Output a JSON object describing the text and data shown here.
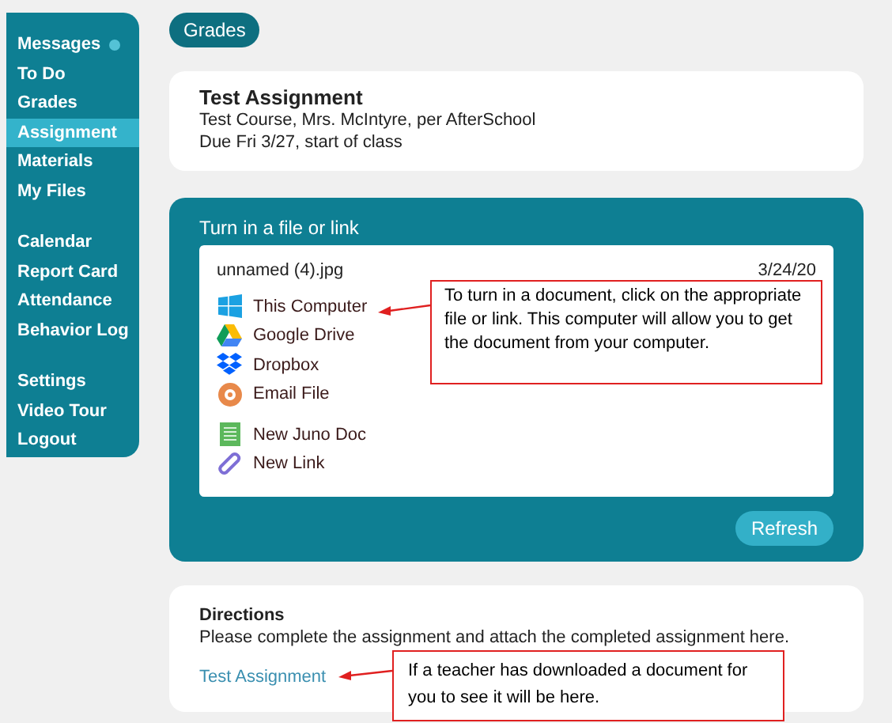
{
  "sidebar": {
    "groups": [
      [
        {
          "label": "Messages",
          "selected": false,
          "unread": true
        },
        {
          "label": "To Do",
          "selected": false,
          "unread": false
        },
        {
          "label": "Grades",
          "selected": false,
          "unread": false
        },
        {
          "label": "Assignment",
          "selected": true,
          "unread": false
        },
        {
          "label": "Materials",
          "selected": false,
          "unread": false
        },
        {
          "label": "My Files",
          "selected": false,
          "unread": false
        }
      ],
      [
        {
          "label": "Calendar",
          "selected": false,
          "unread": false
        },
        {
          "label": "Report Card",
          "selected": false,
          "unread": false
        },
        {
          "label": "Attendance",
          "selected": false,
          "unread": false
        },
        {
          "label": "Behavior Log",
          "selected": false,
          "unread": false
        }
      ],
      [
        {
          "label": "Settings",
          "selected": false,
          "unread": false
        },
        {
          "label": "Video Tour",
          "selected": false,
          "unread": false
        },
        {
          "label": "Logout",
          "selected": false,
          "unread": false
        }
      ]
    ]
  },
  "breadcrumb": "Grades",
  "assignment": {
    "title": "Test Assignment",
    "course": "Test Course, Mrs. McIntyre, per AfterSchool",
    "due": "Due Fri 3/27, start of class"
  },
  "turn_in": {
    "heading": "Turn in a file or link",
    "file_name": "unnamed (4).jpg",
    "file_date": "3/24/20",
    "source_groups": [
      [
        {
          "kind": "windows",
          "label": "This Computer"
        },
        {
          "kind": "drive",
          "label": "Google Drive"
        },
        {
          "kind": "dropbox",
          "label": "Dropbox"
        },
        {
          "kind": "email",
          "label": "Email File"
        }
      ],
      [
        {
          "kind": "doc",
          "label": "New Juno Doc"
        },
        {
          "kind": "link",
          "label": "New Link"
        }
      ]
    ],
    "refresh": "Refresh"
  },
  "directions": {
    "heading": "Directions",
    "text": "Please complete the assignment and attach the completed assignment here.",
    "link": "Test Assignment"
  },
  "callouts": [
    {
      "text": "To turn in a document, click on the appropriate file or link. This computer will allow you to get the document from your computer."
    },
    {
      "text": "If a teacher has downloaded a document for you to see it will be here."
    }
  ]
}
